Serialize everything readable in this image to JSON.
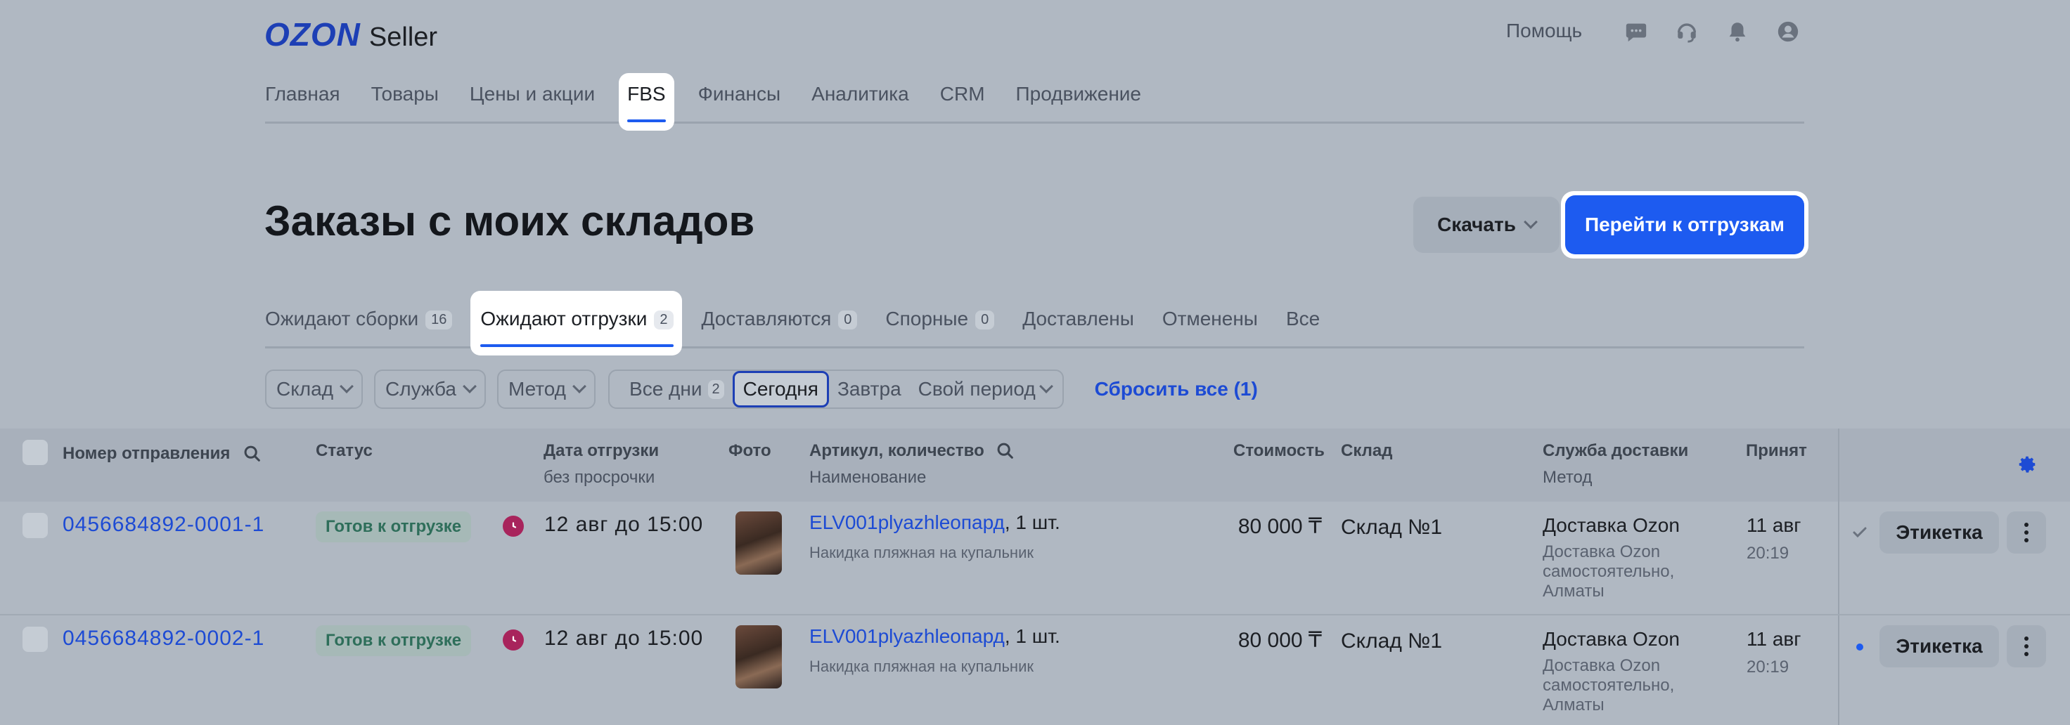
{
  "header": {
    "logo_brand": "OZON",
    "logo_product": "Seller",
    "help": "Помощь",
    "icons": [
      "chat-icon",
      "headset-icon",
      "bell-icon",
      "profile-icon"
    ]
  },
  "nav": {
    "items": [
      {
        "label": "Главная"
      },
      {
        "label": "Товары"
      },
      {
        "label": "Цены и акции"
      },
      {
        "label": "FBS",
        "active": true
      },
      {
        "label": "Финансы"
      },
      {
        "label": "Аналитика"
      },
      {
        "label": "CRM"
      },
      {
        "label": "Продвижение"
      }
    ]
  },
  "page": {
    "title": "Заказы с моих складов",
    "download_label": "Скачать",
    "primary_label": "Перейти к отгрузкам"
  },
  "tabs": [
    {
      "label": "Ожидают сборки",
      "count": "16"
    },
    {
      "label": "Ожидают отгрузки",
      "count": "2",
      "active": true
    },
    {
      "label": "Доставляются",
      "count": "0"
    },
    {
      "label": "Спорные",
      "count": "0"
    },
    {
      "label": "Доставлены",
      "count": ""
    },
    {
      "label": "Отменены",
      "count": ""
    },
    {
      "label": "Все",
      "count": ""
    }
  ],
  "filters": {
    "warehouse": "Склад",
    "service": "Служба",
    "method": "Метод",
    "period_all": "Все дни",
    "period_all_count": "2",
    "period_today": "Сегодня",
    "period_tomorrow": "Завтра",
    "period_custom": "Свой период",
    "reset": "Сбросить все (1)"
  },
  "table": {
    "columns": {
      "order": "Номер отправления",
      "status": "Статус",
      "ship_date": "Дата отгрузки",
      "ship_date_sub": "без просрочки",
      "photo": "Фото",
      "sku": "Артикул, количество",
      "sku_sub": "Наименование",
      "price": "Стоимость",
      "warehouse": "Склад",
      "delivery": "Служба доставки",
      "delivery_sub": "Метод",
      "accepted": "Принят"
    },
    "rows": [
      {
        "order": "0456684892-0001-1",
        "status": "Готов к отгрузке",
        "ship_date": "12 авг до 15:00",
        "sku": "ELV001plyazhleопард",
        "qty": ", 1 шт.",
        "name": "Накидка пляжная на купальник",
        "price": "80 000 ₸",
        "warehouse": "Склад №1",
        "delivery": "Доставка Ozon",
        "method": "Доставка Ozon самостоятельно, Алматы",
        "accepted_date": "11 авг",
        "accepted_time": "20:19",
        "label_button": "Этикетка",
        "mark": "check"
      },
      {
        "order": "0456684892-0002-1",
        "status": "Готов к отгрузке",
        "ship_date": "12 авг до 15:00",
        "sku": "ELV001plyazhleопард",
        "qty": ", 1 шт.",
        "name": "Накидка пляжная на купальник",
        "price": "80 000 ₸",
        "warehouse": "Склад №1",
        "delivery": "Доставка Ozon",
        "method": "Доставка Ozon самостоятельно, Алматы",
        "accepted_date": "11 авг",
        "accepted_time": "20:19",
        "label_button": "Этикетка",
        "mark": "dot"
      }
    ]
  },
  "colors": {
    "accent": "#1d5bf0",
    "link": "#1d4bd4",
    "status_bg": "#a6b9b7",
    "clock": "#a8245c"
  }
}
